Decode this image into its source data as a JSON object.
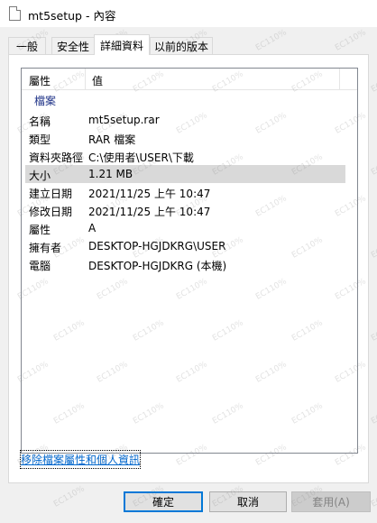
{
  "window": {
    "title": "mt5setup - 內容"
  },
  "tabs": [
    {
      "label": "一般"
    },
    {
      "label": "安全性"
    },
    {
      "label": "詳細資料"
    },
    {
      "label": "以前的版本"
    }
  ],
  "details": {
    "columns": {
      "property": "屬性",
      "value": "值"
    },
    "group": "檔案",
    "rows": [
      {
        "key": "名稱",
        "value": "mt5setup.rar"
      },
      {
        "key": "類型",
        "value": "RAR 檔案"
      },
      {
        "key": "資料夾路徑",
        "value": "C:\\使用者\\USER\\下載"
      },
      {
        "key": "大小",
        "value": "1.21 MB"
      },
      {
        "key": "建立日期",
        "value": "2021/11/25 上午 10:47"
      },
      {
        "key": "修改日期",
        "value": "2021/11/25 上午 10:47"
      },
      {
        "key": "屬性",
        "value": "A"
      },
      {
        "key": "擁有者",
        "value": "DESKTOP-HGJDKRG\\USER"
      },
      {
        "key": "電腦",
        "value": "DESKTOP-HGJDKRG (本機)"
      }
    ],
    "selected_row": 3
  },
  "remove_link": "移除檔案屬性和個人資訊",
  "buttons": {
    "ok": "確定",
    "cancel": "取消",
    "apply": "套用(A)"
  },
  "watermark_text": "EC110%"
}
